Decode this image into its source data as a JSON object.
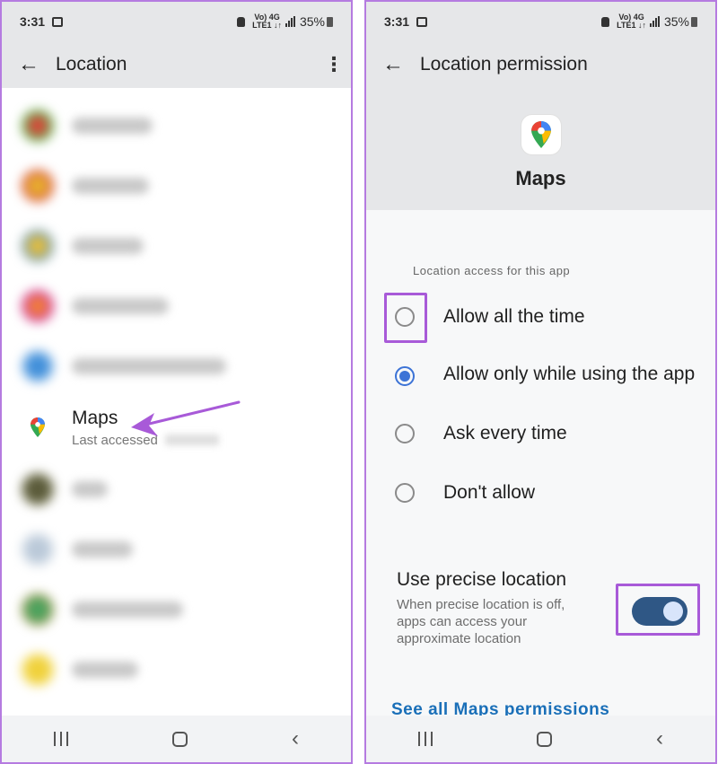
{
  "status_bar": {
    "time": "3:31",
    "network_line1": "Vo) 4G",
    "network_line2": "LTE1 ↓↑",
    "battery": "35%"
  },
  "left_screen": {
    "title": "Location",
    "blurred_rows": [
      {
        "icon_color": "#e0453a"
      },
      {
        "icon_color": "#e9b52f"
      },
      {
        "icon_color": "#f2c230"
      },
      {
        "icon_color": "#d93f8f"
      },
      {
        "icon_color": "#3f8ed9"
      }
    ],
    "maps_row": {
      "name": "Maps",
      "subtitle": "Last accessed"
    },
    "blurred_rows_after": [
      {
        "icon_color": "#5a5a3a"
      },
      {
        "icon_color": "#b9c8d8"
      },
      {
        "icon_color": "#49a35f"
      },
      {
        "icon_color": "#f0d13a"
      }
    ]
  },
  "right_screen": {
    "title": "Location permission",
    "app_name": "Maps",
    "section_label": "Location access for this app",
    "options": [
      {
        "label": "Allow all the time",
        "selected": false
      },
      {
        "label": "Allow only while using the app",
        "selected": true
      },
      {
        "label": "Ask every time",
        "selected": false
      },
      {
        "label": "Don't allow",
        "selected": false
      }
    ],
    "precise": {
      "title": "Use precise location",
      "description": "When precise location is off, apps can access your approximate location",
      "enabled": true
    },
    "see_all_link": "See all Maps permissions"
  },
  "colors": {
    "highlight": "#a85ad8",
    "accent_blue": "#3c73d6",
    "link": "#1a6fb8",
    "toggle_track": "#2f5785"
  }
}
